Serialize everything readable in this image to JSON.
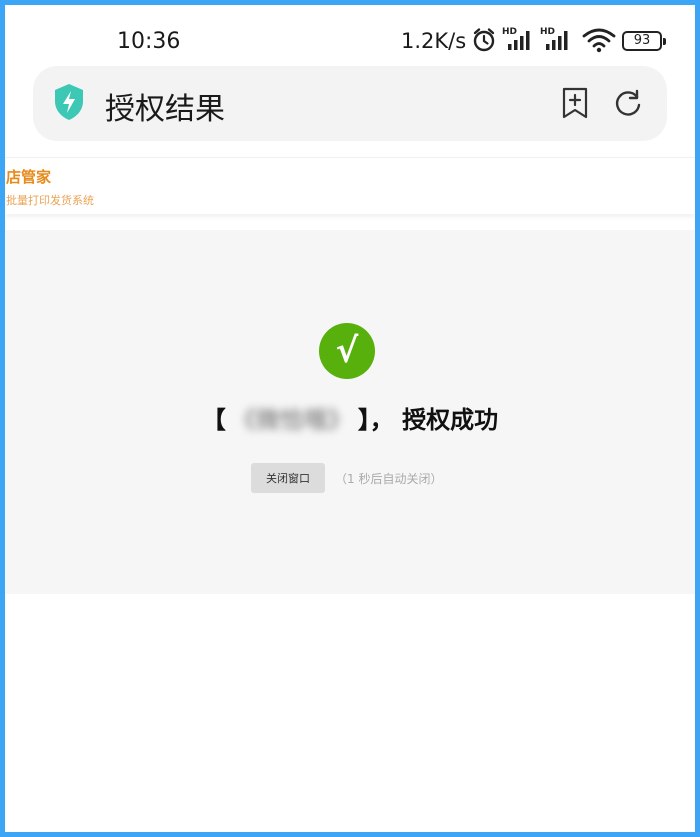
{
  "status_bar": {
    "time": "10:36",
    "net_speed": "1.2K/s",
    "battery": "93",
    "icons": [
      "alarm-icon",
      "hd-signal-icon",
      "hd-signal-icon",
      "wifi-icon",
      "battery-icon"
    ]
  },
  "address_bar": {
    "title": "授权结果",
    "icons": [
      "shield-icon",
      "bookmark-add-icon",
      "reload-icon"
    ],
    "accent": "#3cc8b4"
  },
  "site": {
    "brand_name": "店管家",
    "brand_tagline": "批量打印发货系统",
    "brand_color": "#e78a1a"
  },
  "result": {
    "check_symbol": "√",
    "open_bracket": "【",
    "shop_name": "《微恰哦》",
    "close_bracket": "】，",
    "message": "授权成功",
    "check_color": "#58b00c"
  },
  "actions": {
    "close_label": "关闭窗口",
    "countdown": "（1 秒后自动关闭）"
  }
}
